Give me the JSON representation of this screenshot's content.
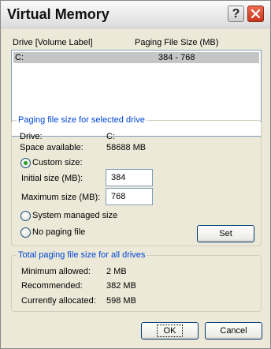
{
  "window": {
    "title": "Virtual Memory"
  },
  "titlebar_buttons": {
    "help_glyph": "?",
    "close_icon": "close-x"
  },
  "drive_list": {
    "col_drive": "Drive  [Volume Label]",
    "col_size": "Paging File Size (MB)",
    "rows": [
      {
        "drive": "C:",
        "size": "384 - 768"
      }
    ]
  },
  "selected_drive": {
    "legend": "Paging file size for selected drive",
    "drive_label": "Drive:",
    "drive_value": "C:",
    "space_label": "Space available:",
    "space_value": "58688 MB",
    "custom_size_label": "Custom size:",
    "initial_label": "Initial size (MB):",
    "initial_value": "384",
    "maximum_label": "Maximum size (MB):",
    "maximum_value": "768",
    "system_managed_label": "System managed size",
    "no_paging_label": "No paging file",
    "set_button": "Set",
    "selected_option": "custom"
  },
  "totals": {
    "legend": "Total paging file size for all drives",
    "min_label": "Minimum allowed:",
    "min_value": "2 MB",
    "rec_label": "Recommended:",
    "rec_value": "382 MB",
    "cur_label": "Currently allocated:",
    "cur_value": "598 MB"
  },
  "buttons": {
    "ok": "OK",
    "cancel": "Cancel"
  },
  "colors": {
    "group_legend": "#0046d5",
    "radio_selected": "#21a121",
    "close_button": "#d9472b"
  }
}
